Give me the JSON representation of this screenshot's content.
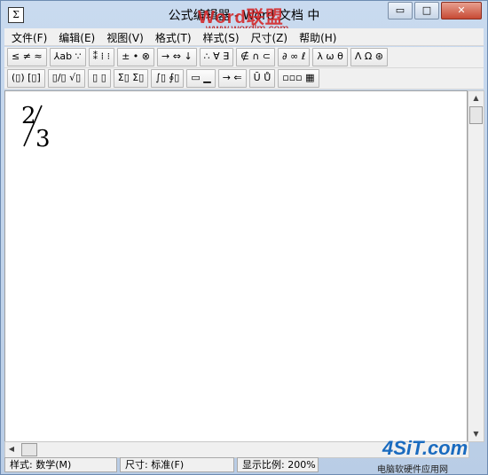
{
  "window": {
    "title": "公式编辑器 - Word 文档 中",
    "app_icon_glyph": "Σ",
    "buttons": {
      "minimize": "▭",
      "maximize": "□",
      "close": "✕"
    }
  },
  "watermark": {
    "brand": "Word联盟",
    "url": "www.wordlm.com",
    "site_logo": "4SiT.com",
    "site_sub": "电脑软硬件应用网"
  },
  "menubar": [
    "文件(F)",
    "编辑(E)",
    "视图(V)",
    "格式(T)",
    "样式(S)",
    "尺寸(Z)",
    "帮助(H)"
  ],
  "toolbar_row1": [
    "≤ ≠ ≈",
    "⅄ab ∵",
    "⁑ ⁞ ⁝",
    "± • ⊗",
    "→ ⇔ ↓",
    "∴ ∀ ∃",
    "∉ ∩ ⊂",
    "∂ ∞ ℓ",
    "λ ω θ",
    "Λ Ω ⊛"
  ],
  "toolbar_row2": [
    "(▯) [▯]",
    "▯/▯ √▯",
    "▯ ▯",
    "Σ▯ Σ▯",
    "∫▯ ∮▯",
    "▭ ▁",
    "→ ⇐",
    "Ū Ů",
    "▫▫▫ ▦"
  ],
  "equation": {
    "numerator": "2",
    "denominator": "3"
  },
  "status": {
    "style": "样式: 数学(M)",
    "size": "尺寸: 标准(F)",
    "zoom": "显示比例: 200%"
  },
  "colors": {
    "accent": "#c74a34",
    "watermark": "#d62020",
    "logo": "#1a6bbf"
  }
}
